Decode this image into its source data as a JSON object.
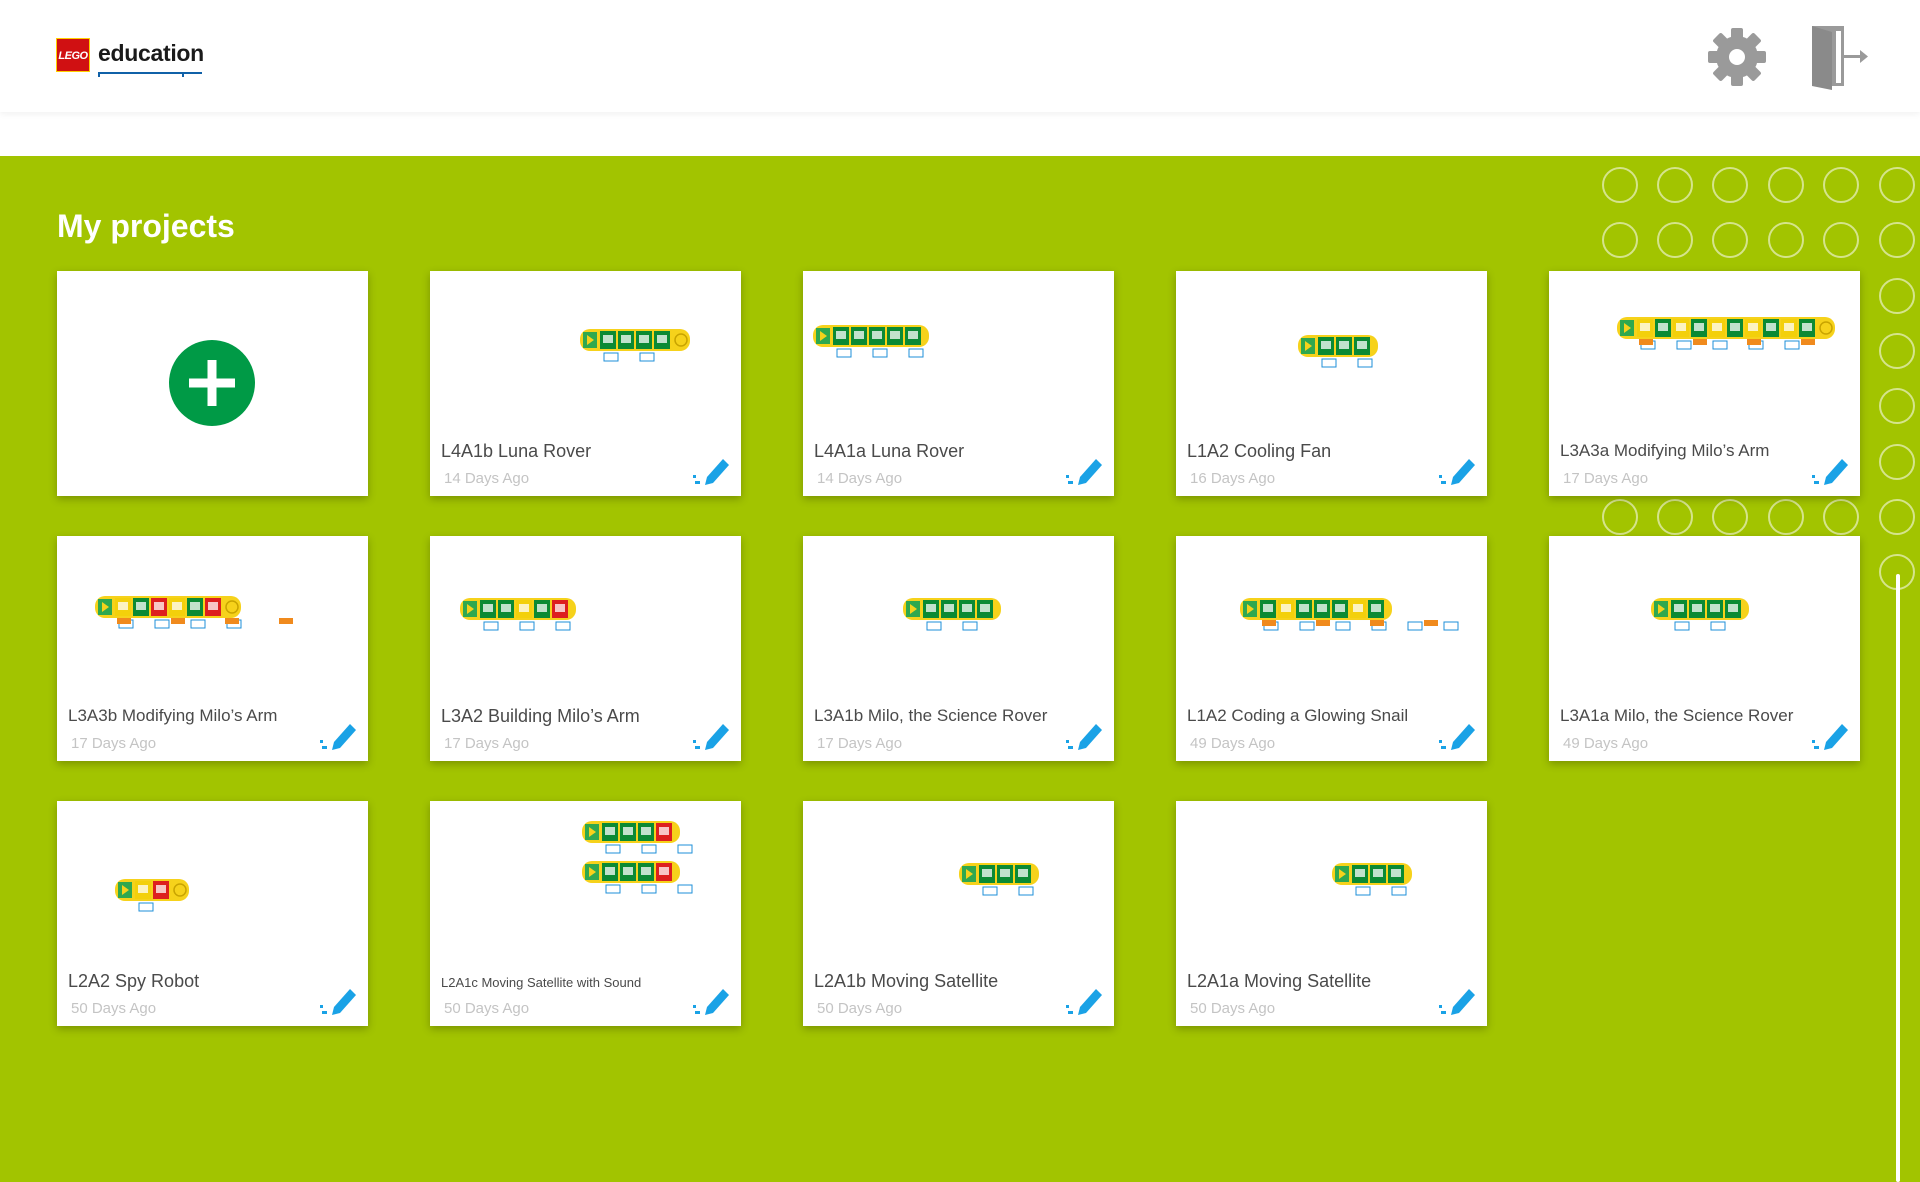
{
  "header": {
    "logo": {
      "brick_text": "LEGO",
      "word": "education"
    },
    "settings_icon": "gear-icon",
    "exit_icon": "door-exit-icon"
  },
  "main": {
    "title": "My projects",
    "new_project_icon": "plus-icon",
    "edit_icon": "pencil-icon"
  },
  "colors": {
    "background": "#a2c400",
    "new_project_button": "#009a46",
    "edit_icon": "#1aa2e6",
    "header_icons": "#9a9a9a"
  },
  "projects": [
    {
      "name": "L4A1b Luna Rover",
      "date": "14 Days Ago"
    },
    {
      "name": "L4A1a Luna Rover",
      "date": "14 Days Ago"
    },
    {
      "name": "L1A2 Cooling Fan",
      "date": "16 Days Ago"
    },
    {
      "name": "L3A3a Modifying Milo’s Arm",
      "date": "17 Days Ago"
    },
    {
      "name": "L3A3b Modifying Milo’s Arm",
      "date": "17 Days Ago"
    },
    {
      "name": "L3A2 Building Milo’s Arm",
      "date": "17 Days Ago"
    },
    {
      "name": "L3A1b Milo, the Science Rover",
      "date": "17 Days Ago"
    },
    {
      "name": "L1A2 Coding a Glowing Snail",
      "date": "49 Days Ago"
    },
    {
      "name": "L3A1a Milo, the Science Rover",
      "date": "49 Days Ago"
    },
    {
      "name": "L2A2 Spy Robot",
      "date": "50 Days Ago"
    },
    {
      "name": "L2A1c Moving Satellite with Sound",
      "date": "50 Days Ago"
    },
    {
      "name": "L2A1b Moving Satellite",
      "date": "50 Days Ago"
    },
    {
      "name": "L2A1a Moving Satellite",
      "date": "50 Days Ago"
    }
  ]
}
